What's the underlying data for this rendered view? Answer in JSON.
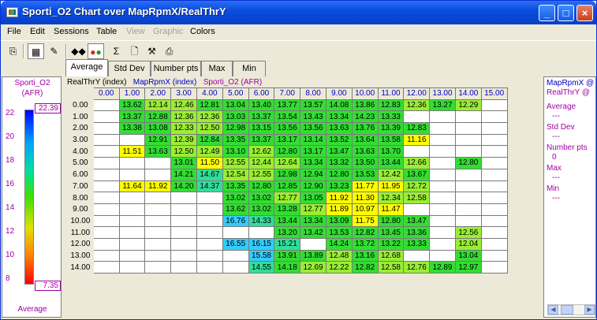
{
  "window": {
    "title": "Sporti_O2 Chart over MapRpmX/RealThrY"
  },
  "menu": [
    {
      "label": "File",
      "enabled": true
    },
    {
      "label": "Edit",
      "enabled": true
    },
    {
      "label": "Sessions",
      "enabled": true
    },
    {
      "label": "Table",
      "enabled": true
    },
    {
      "label": "View",
      "enabled": false
    },
    {
      "label": "Graphic",
      "enabled": false
    },
    {
      "label": "Colors",
      "enabled": true
    }
  ],
  "tabs": [
    "Average",
    "Std Dev",
    "Number pts",
    "Max",
    "Min"
  ],
  "active_tab": "Average",
  "legend": {
    "title_line1": "Sporti_O2",
    "title_line2": "(AFR)",
    "max_box": "22.39",
    "min_box": "7.35",
    "ticks": [
      "22",
      "20",
      "18",
      "16",
      "14",
      "12",
      "10",
      "8"
    ],
    "footer": "Average"
  },
  "grid": {
    "header_y": "RealThrY (index)",
    "header_x": "MapRpmX (index)",
    "header_z": "Sporti_O2 (AFR)",
    "columns": [
      "0.00",
      "1.00",
      "2.00",
      "3.00",
      "4.00",
      "5.00",
      "6.00",
      "7.00",
      "8.00",
      "9.00",
      "10.00",
      "11.00",
      "12.00",
      "13.00",
      "14.00",
      "15.00"
    ],
    "rows": [
      {
        "label": "0.00",
        "cells": [
          "",
          "13.62",
          "12.14",
          "12.46",
          "12.81",
          "13.04",
          "13.40",
          "13.77",
          "13.57",
          "14.08",
          "13.86",
          "12.83",
          "12.36",
          "13.27",
          "12.29",
          ""
        ]
      },
      {
        "label": "1.00",
        "cells": [
          "",
          "13.37",
          "12.88",
          "12.36",
          "12.36",
          "13.03",
          "13.37",
          "13.54",
          "13.43",
          "13.34",
          "14.23",
          "13.33",
          "",
          "",
          "",
          ""
        ]
      },
      {
        "label": "2.00",
        "cells": [
          "",
          "13.38",
          "13.08",
          "12.33",
          "12.50",
          "12.98",
          "13.15",
          "13.56",
          "13.56",
          "13.63",
          "13.76",
          "13.39",
          "12.83",
          "",
          "",
          ""
        ]
      },
      {
        "label": "3.00",
        "cells": [
          "",
          "",
          "12.91",
          "12.39",
          "12.84",
          "13.35",
          "13.37",
          "13.17",
          "13.14",
          "13.52",
          "13.64",
          "13.58",
          "11.16",
          "",
          "",
          ""
        ]
      },
      {
        "label": "4.00",
        "cells": [
          "",
          "11.51",
          "13.63",
          "12.50",
          "12.49",
          "13.10",
          "12.62",
          "12.80",
          "13.17",
          "13.47",
          "13.63",
          "13.70",
          "",
          "",
          "",
          ""
        ]
      },
      {
        "label": "5.00",
        "cells": [
          "",
          "",
          "",
          "13.01",
          "11.50",
          "12.55",
          "12.44",
          "12.64",
          "13.34",
          "13.32",
          "13.50",
          "13.44",
          "12.66",
          "",
          "12.80",
          ""
        ]
      },
      {
        "label": "6.00",
        "cells": [
          "",
          "",
          "",
          "14.21",
          "14.67",
          "12.54",
          "12.55",
          "12.98",
          "12.94",
          "12.80",
          "13.53",
          "12.42",
          "13.67",
          "",
          "",
          ""
        ]
      },
      {
        "label": "7.00",
        "cells": [
          "",
          "11.64",
          "11.92",
          "14.20",
          "14.37",
          "13.35",
          "12.80",
          "12.85",
          "12.90",
          "13.23",
          "11.77",
          "11.95",
          "12.72",
          "",
          "",
          ""
        ]
      },
      {
        "label": "8.00",
        "cells": [
          "",
          "",
          "",
          "",
          "",
          "13.02",
          "13.02",
          "12.77",
          "13.05",
          "11.92",
          "11.30",
          "12.34",
          "12.58",
          "",
          "",
          ""
        ]
      },
      {
        "label": "9.00",
        "cells": [
          "",
          "",
          "",
          "",
          "",
          "13.62",
          "13.02",
          "13.28",
          "12.77",
          "11.89",
          "10.97",
          "11.47",
          "",
          "",
          "",
          ""
        ]
      },
      {
        "label": "10.00",
        "cells": [
          "",
          "",
          "",
          "",
          "",
          "16.76",
          "14.33",
          "13.44",
          "13.34",
          "13.09",
          "11.75",
          "12.80",
          "13.47",
          "",
          "",
          ""
        ]
      },
      {
        "label": "11.00",
        "cells": [
          "",
          "",
          "",
          "",
          "",
          "",
          "",
          "13.20",
          "13.42",
          "13.53",
          "12.82",
          "13.45",
          "13.36",
          "",
          "12.56",
          ""
        ]
      },
      {
        "label": "12.00",
        "cells": [
          "",
          "",
          "",
          "",
          "",
          "16.55",
          "16.15",
          "15.21",
          "",
          "14.24",
          "13.72",
          "13.22",
          "13.33",
          "",
          "12.04",
          ""
        ]
      },
      {
        "label": "13.00",
        "cells": [
          "",
          "",
          "",
          "",
          "",
          "",
          "15.58",
          "13.91",
          "13.89",
          "12.48",
          "13.16",
          "12.68",
          "",
          "",
          "13.04",
          ""
        ]
      },
      {
        "label": "14.00",
        "cells": [
          "",
          "",
          "",
          "",
          "",
          "",
          "14.55",
          "14.18",
          "12.69",
          "12.22",
          "12.82",
          "12.58",
          "12.76",
          "12.89",
          "12.97",
          ""
        ]
      }
    ]
  },
  "stats": {
    "header_line1": "MapRpmX @",
    "header_line2": "RealThrY @",
    "items": [
      {
        "label": "Average",
        "value": "---"
      },
      {
        "label": "Std Dev",
        "value": "---"
      },
      {
        "label": "Number pts",
        "value": "0"
      },
      {
        "label": "Max",
        "value": "---"
      },
      {
        "label": "Min",
        "value": "---"
      }
    ]
  },
  "colors": {
    "green": "#33dd33",
    "light_green": "#99ee33",
    "yellow": "#ffff00",
    "cyan_green": "#33dd99",
    "cyan": "#33ccff"
  }
}
